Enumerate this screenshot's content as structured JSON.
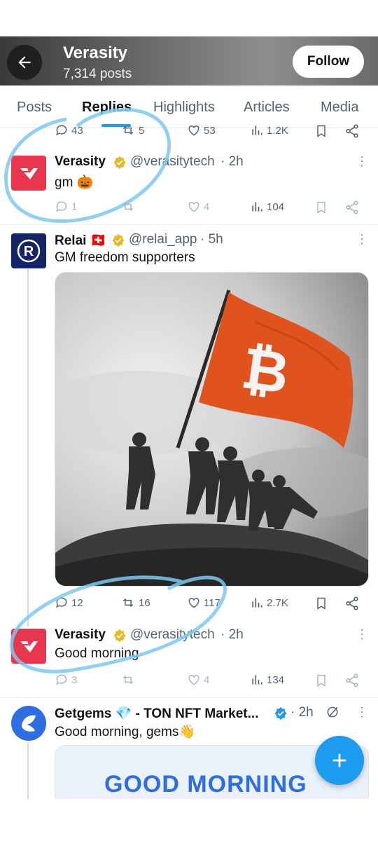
{
  "header": {
    "title": "Verasity",
    "posts_count": "7,314 posts",
    "follow_label": "Follow"
  },
  "tabs": [
    {
      "label": "Posts"
    },
    {
      "label": "Replies"
    },
    {
      "label": "Highlights"
    },
    {
      "label": "Articles"
    },
    {
      "label": "Media"
    }
  ],
  "prev_actions": {
    "replies": "43",
    "reposts": "5",
    "likes": "53",
    "views": "1.2K"
  },
  "tweets": [
    {
      "name": "Verasity",
      "handle": "@verasitytech",
      "time": "· 2h",
      "text": "gm 🎃",
      "replies": "1",
      "reposts": "",
      "likes": "4",
      "views": "104"
    },
    {
      "name": "Relai 🇨🇭",
      "handle": "@relai_app",
      "time": "· 5h",
      "text": "GM freedom supporters",
      "replies": "12",
      "reposts": "16",
      "likes": "117",
      "views": "2.7K"
    },
    {
      "name": "Verasity",
      "handle": "@verasitytech",
      "time": "· 2h",
      "text": "Good morning",
      "replies": "3",
      "reposts": "",
      "likes": "4",
      "views": "134"
    },
    {
      "name": "Getgems 💎 - TON NFT Market...",
      "handle": "",
      "time": "· 2h",
      "text": "Good morning, gems👋"
    }
  ],
  "getgems_media_text": "GOOD MORNING",
  "colors": {
    "accent": "#1d9bf0",
    "verified_gold": "#e8b923",
    "verified_blue": "#1d9bf0",
    "highlight": "#7cc8f0",
    "flag": "#e0531c"
  }
}
